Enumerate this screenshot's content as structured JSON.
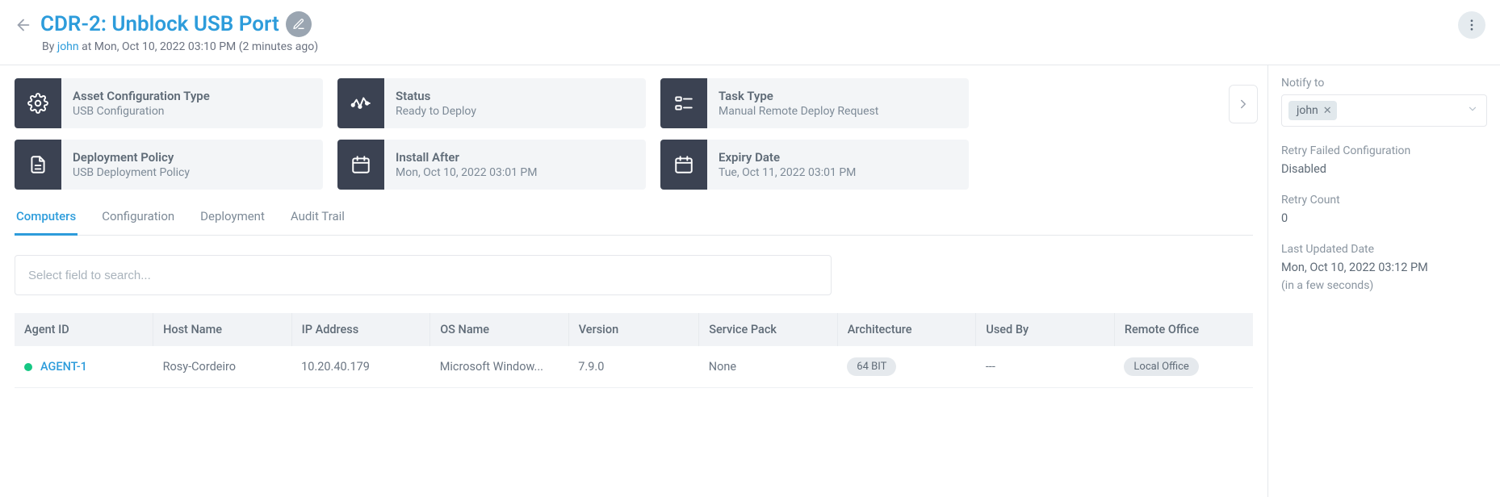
{
  "header": {
    "title": "CDR-2: Unblock USB Port",
    "by_label": "By",
    "author": "john",
    "at_label": "at",
    "timestamp": "Mon, Oct 10, 2022 03:10 PM",
    "relative": "(2 minutes ago)"
  },
  "cards": [
    {
      "icon": "gear",
      "label": "Asset Configuration Type",
      "value": "USB Configuration"
    },
    {
      "icon": "pulse",
      "label": "Status",
      "value": "Ready to Deploy"
    },
    {
      "icon": "task",
      "label": "Task Type",
      "value": "Manual Remote Deploy Request"
    },
    {
      "icon": "doc",
      "label": "Deployment Policy",
      "value": "USB Deployment Policy"
    },
    {
      "icon": "calendar",
      "label": "Install After",
      "value": "Mon, Oct 10, 2022 03:01 PM"
    },
    {
      "icon": "calendar",
      "label": "Expiry Date",
      "value": "Tue, Oct 11, 2022 03:01 PM"
    }
  ],
  "tabs": [
    {
      "label": "Computers",
      "active": true
    },
    {
      "label": "Configuration",
      "active": false
    },
    {
      "label": "Deployment",
      "active": false
    },
    {
      "label": "Audit Trail",
      "active": false
    }
  ],
  "search": {
    "placeholder": "Select field to search..."
  },
  "table": {
    "columns": [
      "Agent ID",
      "Host Name",
      "IP Address",
      "OS Name",
      "Version",
      "Service Pack",
      "Architecture",
      "Used By",
      "Remote Office"
    ],
    "rows": [
      {
        "status_color": "#16c784",
        "agent_id": "AGENT-1",
        "host_name": "Rosy-Cordeiro",
        "ip": "10.20.40.179",
        "os": "Microsoft Window...",
        "version": "7.9.0",
        "service_pack": "None",
        "arch": "64 BIT",
        "used_by": "---",
        "remote_office": "Local Office"
      }
    ]
  },
  "sidebar": {
    "notify_label": "Notify to",
    "notify_chip": "john",
    "retry_label": "Retry Failed Configuration",
    "retry_value": "Disabled",
    "retry_count_label": "Retry Count",
    "retry_count_value": "0",
    "updated_label": "Last Updated Date",
    "updated_value": "Mon, Oct 10, 2022 03:12 PM",
    "updated_relative": "(in a few seconds)"
  }
}
